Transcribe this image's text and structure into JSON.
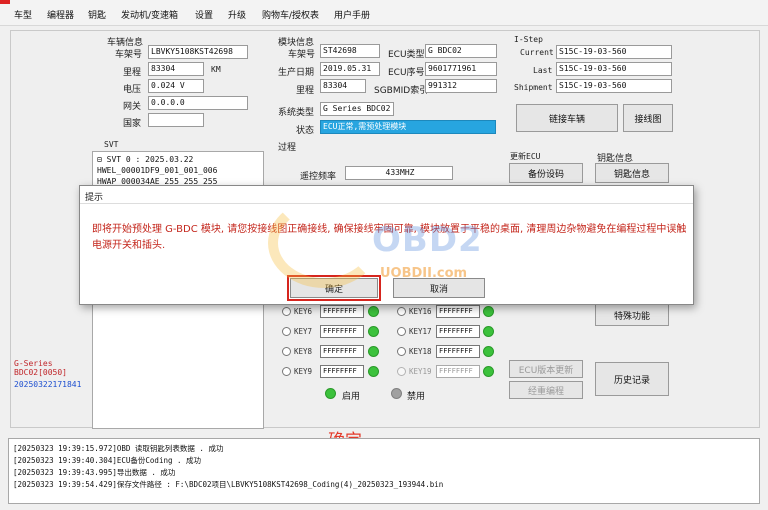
{
  "menu": [
    "车型",
    "编程器",
    "钥匙",
    "发动机/变速箱",
    "设置",
    "升级",
    "购物车/授权表",
    "用户手册"
  ],
  "vehicle": {
    "section": "车辆信息",
    "vin_label": "车架号",
    "vin": "LBVKY5108KST42698",
    "mileage_label": "里程",
    "mileage": "83304",
    "mileage_unit": "KM",
    "voltage_label": "电压",
    "voltage": "0.024 V",
    "gateway_label": "网关",
    "gateway": "0.0.0.0",
    "country_label": "国家",
    "country": ""
  },
  "module": {
    "section": "模块信息",
    "vin_label": "车架号",
    "vin": "ST42698",
    "ecu_type_label": "ECU类型",
    "ecu_type": "G BDC02",
    "date_label": "生产日期",
    "date": "2019.05.31",
    "ecu_no_label": "ECU序号",
    "ecu_no": "9601771961",
    "mileage_label": "里程",
    "mileage": "83304",
    "sgbmid_label": "SGBMID索引",
    "sgbmid": "991312"
  },
  "istep": {
    "section": "I-Step",
    "current_label": "Current",
    "current": "S15C-19-03-560",
    "last_label": "Last",
    "last": "S15C-19-03-560",
    "shipment_label": "Shipment",
    "shipment": "S15C-19-03-560"
  },
  "system": {
    "type_label": "系统类型",
    "type": "G Series BDC02",
    "status_label": "状态",
    "status": "ECU正常,需预处理模块"
  },
  "buttons": {
    "connect": "链接车辆",
    "wiring": "接线图",
    "backup": "备份设码",
    "key_info": "钥匙信息",
    "special": "特殊功能",
    "history": "历史记录",
    "ecu_update": "ECU版本更新",
    "reprogram": "经重编程"
  },
  "svt": {
    "section": "SVT",
    "rows": [
      "⊟ SVT 0 : 2025.03.22",
      "    HWEL_00001DF9_001_001_006",
      "    HWAP_000034AE_255_255_255"
    ]
  },
  "process": {
    "section": "过程",
    "remote_freq_label": "遥控频率",
    "remote_freq": "433MHZ",
    "update_ecu_label": "更新ECU",
    "key_info_label": "钥匙信息",
    "keys": [
      {
        "label": "KEY6",
        "value": "FFFFFFFF"
      },
      {
        "label": "KEY7",
        "value": "FFFFFFFF"
      },
      {
        "label": "KEY8",
        "value": "FFFFFFFF"
      },
      {
        "label": "KEY9",
        "value": "FFFFFFFF"
      },
      {
        "label": "KEY16",
        "value": "FFFFFFFF"
      },
      {
        "label": "KEY17",
        "value": "FFFFFFFF"
      },
      {
        "label": "KEY18",
        "value": "FFFFFFFF"
      },
      {
        "label": "KEY19",
        "value": "FFFFFFFF"
      }
    ],
    "enabled_label": "启用",
    "disabled_label": "禁用"
  },
  "sidebar": {
    "series": "G-Series",
    "module": "BDC02[0050]",
    "timestamp": "20250322171841"
  },
  "dialog": {
    "title": "提示",
    "message": "即将开始预处理 G-BDC 模块, 请您按接线图正确接线, 确保接线牢固可靠, 模块放置于平稳的桌面, 清理周边杂物避免在编程过程中误触电源开关和插头.",
    "ok": "确定",
    "cancel": "取消"
  },
  "caption": "确定",
  "watermark": {
    "brand": "OBD2",
    "site": "UOBDII.com"
  },
  "log": [
    "[20250323 19:39:15.972]OBD 读取钥匙列表数据 . 成功",
    "[20250323 19:39:40.304]ECU备份Coding . 成功",
    "[20250323 19:39:43.995]导出数据 . 成功",
    "[20250323 19:39:54.429]保存文件路径 : F:\\BDC02项目\\LBVKY5108KST42698_Coding(4)_20250323_193944.bin"
  ]
}
